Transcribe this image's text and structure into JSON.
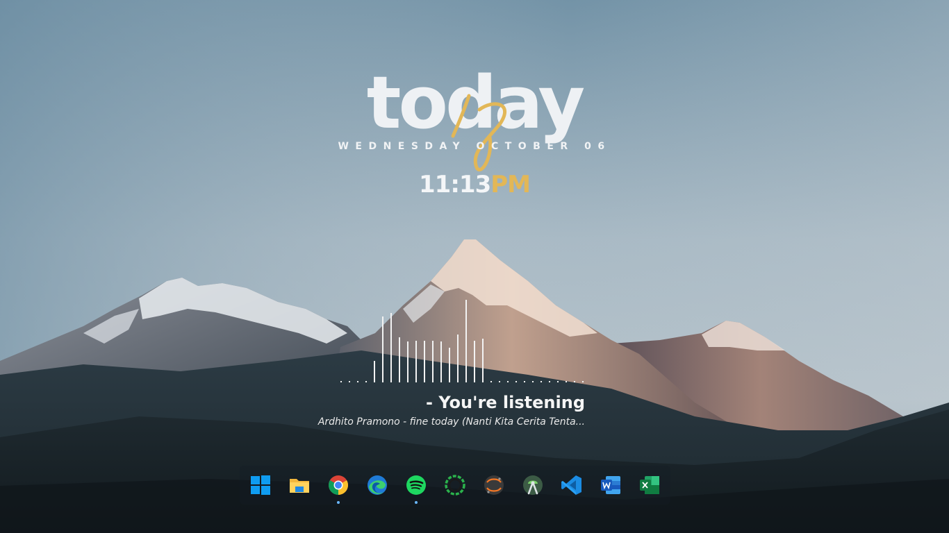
{
  "wallpaper": {
    "subject": "snow-capped mountain range at dusk"
  },
  "clock_widget": {
    "headline": "today",
    "script_word": "is",
    "date": "WEDNESDAY OCTOBER 06",
    "time": "11:13",
    "ampm": "PM",
    "accent_color": "#e2b757"
  },
  "now_playing": {
    "title": "- You're listening",
    "track": "Ardhito Pramono - fine today (Nanti Kita Cerita Tenta...",
    "spectrum_levels": [
      0,
      0,
      0,
      0,
      0.25,
      0.76,
      0.8,
      0.52,
      0.47,
      0.48,
      0.48,
      0.48,
      0.47,
      0.4,
      0.55,
      0.95,
      0.48,
      0.5,
      0,
      0,
      0,
      0,
      0,
      0,
      0,
      0,
      0,
      0,
      0,
      0
    ]
  },
  "dock": {
    "items": [
      {
        "name": "Start",
        "icon": "windows-icon",
        "running": false
      },
      {
        "name": "File Explorer",
        "icon": "folder-icon",
        "running": false
      },
      {
        "name": "Google Chrome",
        "icon": "chrome-icon",
        "running": true
      },
      {
        "name": "Microsoft Edge",
        "icon": "edge-icon",
        "running": false
      },
      {
        "name": "Spotify",
        "icon": "spotify-icon",
        "running": true
      },
      {
        "name": "Circle App",
        "icon": "circle-app-icon",
        "running": false
      },
      {
        "name": "Jupyter",
        "icon": "jupyter-icon",
        "running": false
      },
      {
        "name": "Android Studio",
        "icon": "android-studio-icon",
        "running": false
      },
      {
        "name": "Visual Studio Code",
        "icon": "vscode-icon",
        "running": false
      },
      {
        "name": "Microsoft Word",
        "icon": "word-icon",
        "running": false
      },
      {
        "name": "Microsoft Excel",
        "icon": "excel-icon",
        "running": false
      }
    ]
  }
}
